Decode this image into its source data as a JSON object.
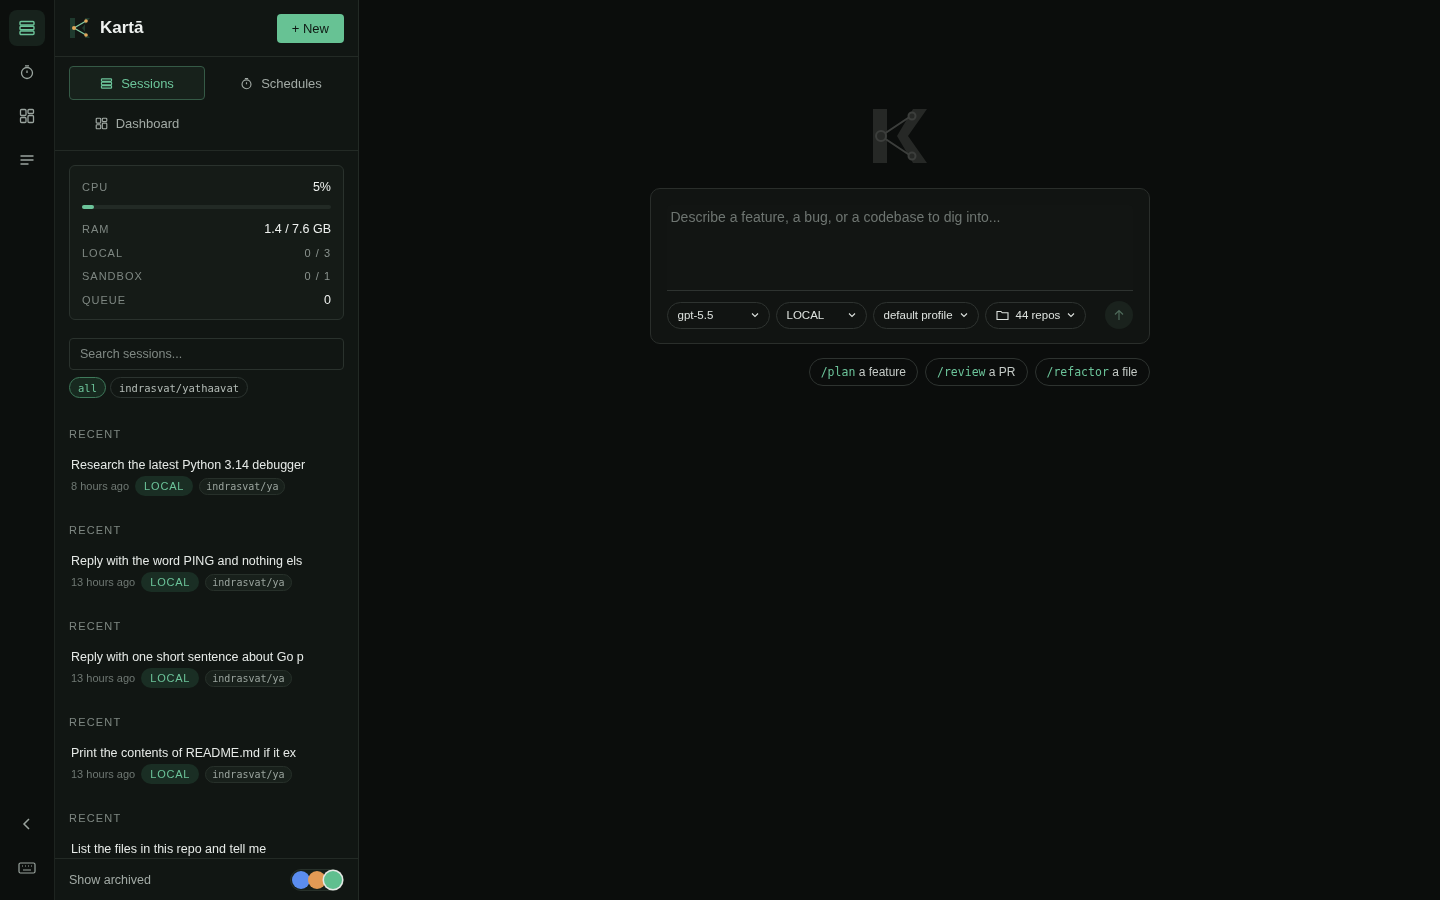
{
  "rail": {
    "items": [
      {
        "kind": "sessions",
        "selected": true
      },
      {
        "kind": "schedules",
        "selected": false
      },
      {
        "kind": "dashboard",
        "selected": false
      },
      {
        "kind": "list",
        "selected": false
      }
    ]
  },
  "sidebar": {
    "brand": "Kartā",
    "new_button": "+ New",
    "tabs": [
      {
        "label": "Sessions",
        "kind": "sessions",
        "selected": true
      },
      {
        "label": "Schedules",
        "kind": "schedules",
        "selected": false
      },
      {
        "label": "Dashboard",
        "kind": "dashboard",
        "selected": false
      }
    ],
    "stats": {
      "cpu": {
        "label": "CPU",
        "value": "5%",
        "level": 0.05
      },
      "rows": [
        {
          "label": "RAM",
          "value": "1.4 / 7.6 GB",
          "kind": "bright"
        },
        {
          "label": "LOCAL",
          "value": "0 / 3",
          "kind": "dim"
        },
        {
          "label": "SANDBOX",
          "value": "0 / 1",
          "kind": "dim"
        },
        {
          "label": "QUEUE",
          "value": "0",
          "kind": "bright"
        }
      ]
    },
    "search": {
      "placeholder": "Search sessions..."
    },
    "filters": [
      {
        "label": "all",
        "selected": true
      },
      {
        "label": "indrasvat/yathaavat",
        "selected": false
      }
    ],
    "sessions": [
      {
        "heading": "RECENT",
        "title": "Research the latest Python 3.14 debugger",
        "time": "8 hours ago",
        "mode": "LOCAL",
        "repo": "indrasvat/ya"
      },
      {
        "heading": "RECENT",
        "title": "Reply with the word PING and nothing els",
        "time": "13 hours ago",
        "mode": "LOCAL",
        "repo": "indrasvat/ya"
      },
      {
        "heading": "RECENT",
        "title": "Reply with one short sentence about Go p",
        "time": "13 hours ago",
        "mode": "LOCAL",
        "repo": "indrasvat/ya"
      },
      {
        "heading": "RECENT",
        "title": "Print the contents of README.md if it ex",
        "time": "13 hours ago",
        "mode": "LOCAL",
        "repo": "indrasvat/ya"
      },
      {
        "heading": "RECENT",
        "title": "List the files in this repo and tell me"
      }
    ],
    "footer": {
      "label": "Show archived",
      "themes": [
        {
          "color": "#5b8def",
          "selected": false
        },
        {
          "color": "#e29a55",
          "selected": false
        },
        {
          "color": "#5fbf8f",
          "selected": true
        }
      ]
    }
  },
  "composer": {
    "placeholder": "Describe a feature, a bug, or a codebase to dig into...",
    "selects": [
      {
        "label": "gpt-5.5",
        "kind": "plain"
      },
      {
        "label": "LOCAL",
        "kind": "plain"
      },
      {
        "label": "default profile",
        "kind": "plain"
      },
      {
        "label": "44 repos",
        "kind": "folder"
      }
    ]
  },
  "suggestions": [
    {
      "command": "/plan",
      "text": "a feature"
    },
    {
      "command": "/review",
      "text": "a PR"
    },
    {
      "command": "/refactor",
      "text": "a file"
    }
  ]
}
